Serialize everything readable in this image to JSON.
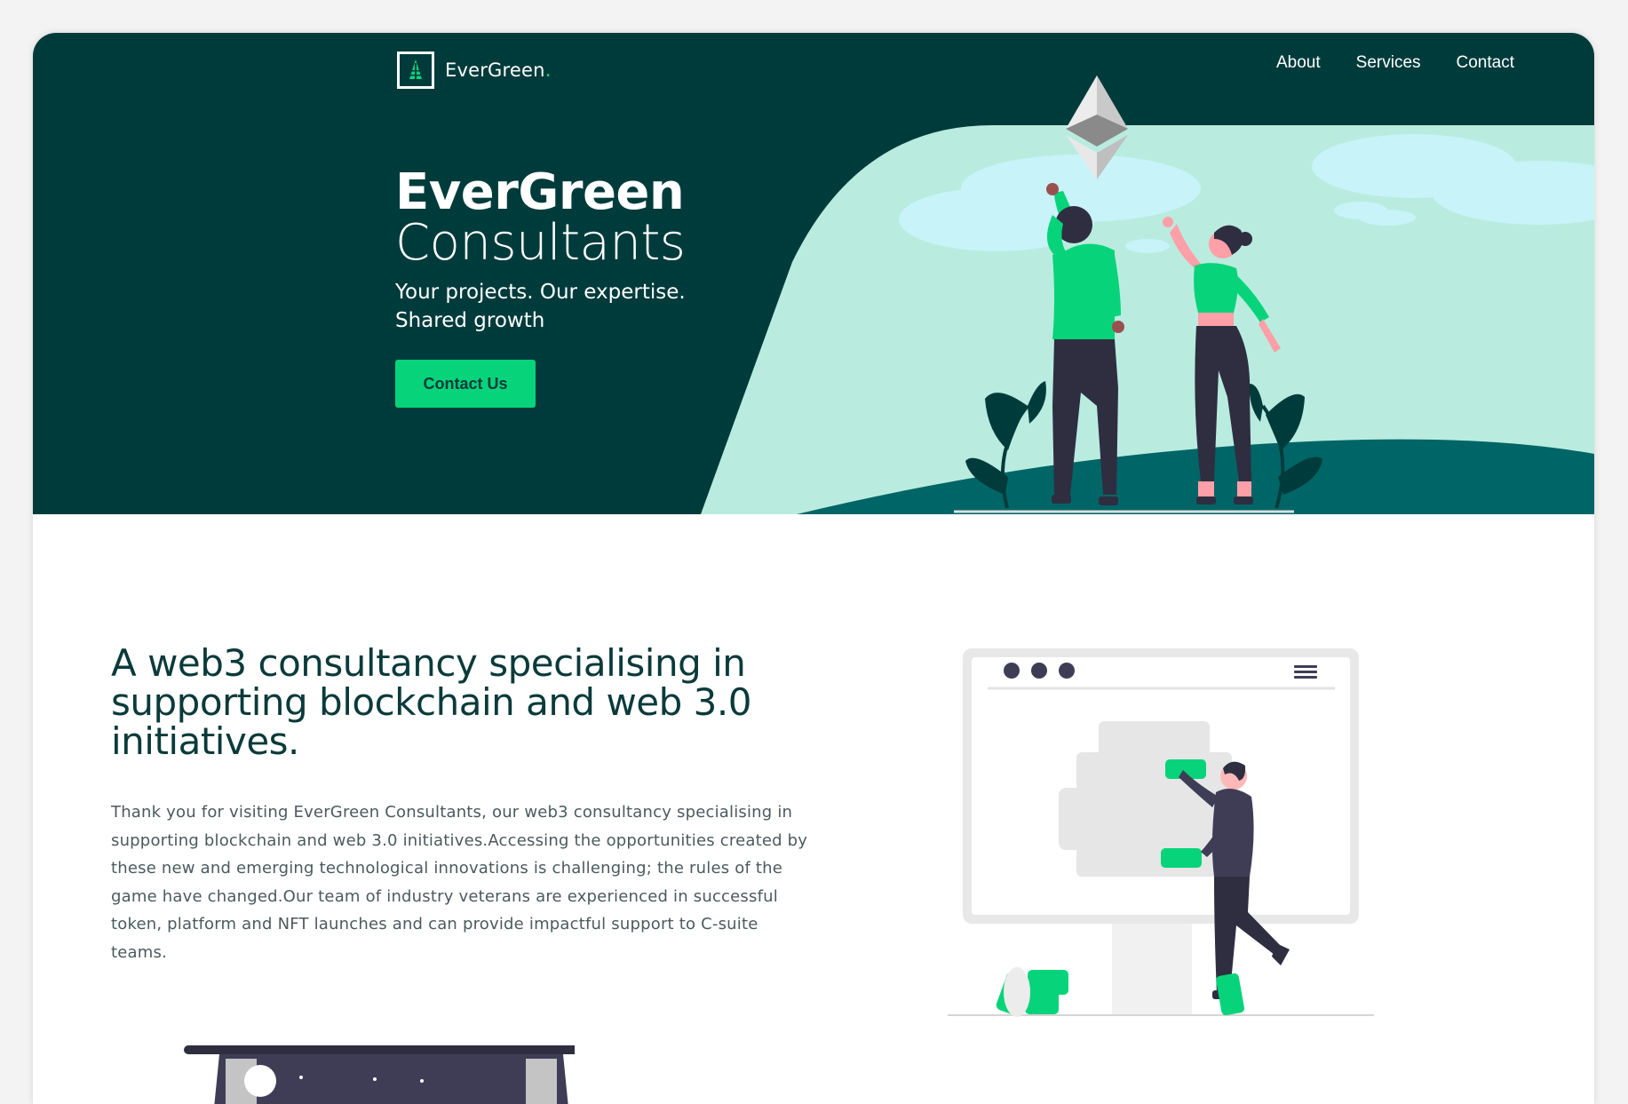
{
  "brand": {
    "name": "EverGreen",
    "dot": ".",
    "accent": "#07d47a",
    "dark": "#003b3c",
    "teal_light": "#b9ecdf",
    "teal_dark": "#006566"
  },
  "nav": {
    "items": [
      {
        "label": "About"
      },
      {
        "label": "Services"
      },
      {
        "label": "Contact"
      }
    ]
  },
  "hero": {
    "title_line1": "EverGreen",
    "title_line2": "Consultants",
    "tagline": "Your projects. Our expertise. Shared growth",
    "cta_label": "Contact Us"
  },
  "intro": {
    "heading": "A web3 consultancy specialising in supporting blockchain and web 3.0 initiatives.",
    "body": "Thank you for visiting EverGreen Consultants, our web3 consultancy specialising in supporting blockchain and web 3.0 initiatives.Accessing the opportunities created by these new and emerging technological innovations is challenging; the rules of the game have changed.Our team of industry veterans are experienced in successful token, platform and NFT launches and can provide impactful support to C-suite teams."
  },
  "icons": {
    "logo": "tree-logo-icon",
    "hero_illustration": "ethereum-celebration-illustration",
    "intro_illustration": "browser-puzzle-illustration",
    "bottom_illustration": "dark-panel-illustration"
  }
}
